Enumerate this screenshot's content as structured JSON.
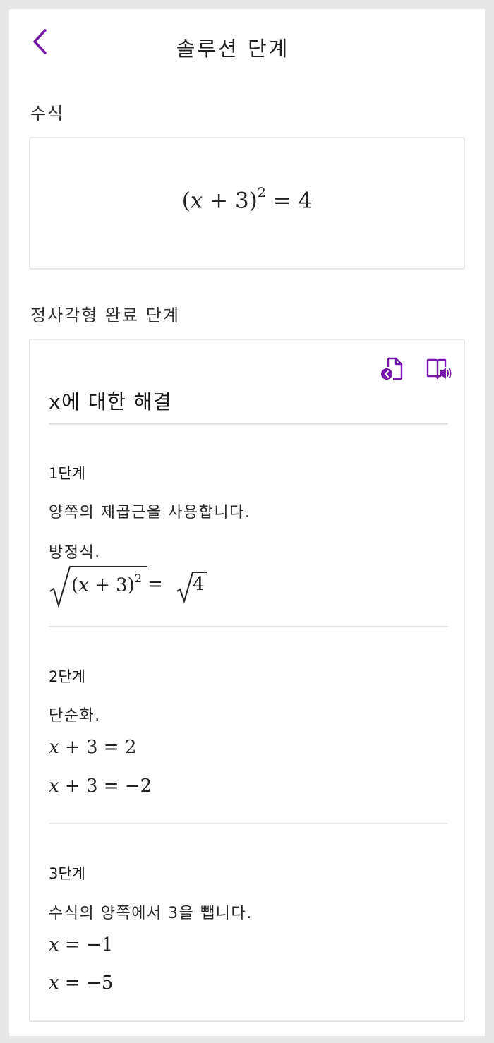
{
  "header": {
    "title": "솔루션 단계",
    "back_icon": "chevron-left-icon",
    "accent_color": "#7719aa"
  },
  "expression_section": {
    "label": "수식",
    "equation": {
      "open": "(",
      "var": "x",
      "rest": " + 3)",
      "exp": "2",
      "rhs": " = 4"
    }
  },
  "method_section": {
    "label": "정사각형 완료 단계"
  },
  "solution_card": {
    "title": "x에 대한 해결",
    "icons": [
      "insert-page-icon",
      "immersive-reader-icon"
    ],
    "steps": [
      {
        "heading": "1단계",
        "text": "양쪽의 제곱근을 사용합니다.",
        "subtext": "방정식.",
        "math": {
          "inner_open": "(",
          "var": "x",
          "inner_rest": " + 3)",
          "exp": "2",
          "mid": " = ",
          "rhs_radicand": "4"
        }
      },
      {
        "heading": "2단계",
        "text": "단순화.",
        "math_lines": [
          {
            "var": "x",
            "rest": " + 3 = 2"
          },
          {
            "var": "x",
            "rest": " + 3 = −2"
          }
        ]
      },
      {
        "heading": "3단계",
        "text": "수식의 양쪽에서 3을 뺍니다.",
        "math_lines": [
          {
            "var": "x",
            "rest": " = −1"
          },
          {
            "var": "x",
            "rest": " = −5"
          }
        ]
      }
    ]
  }
}
